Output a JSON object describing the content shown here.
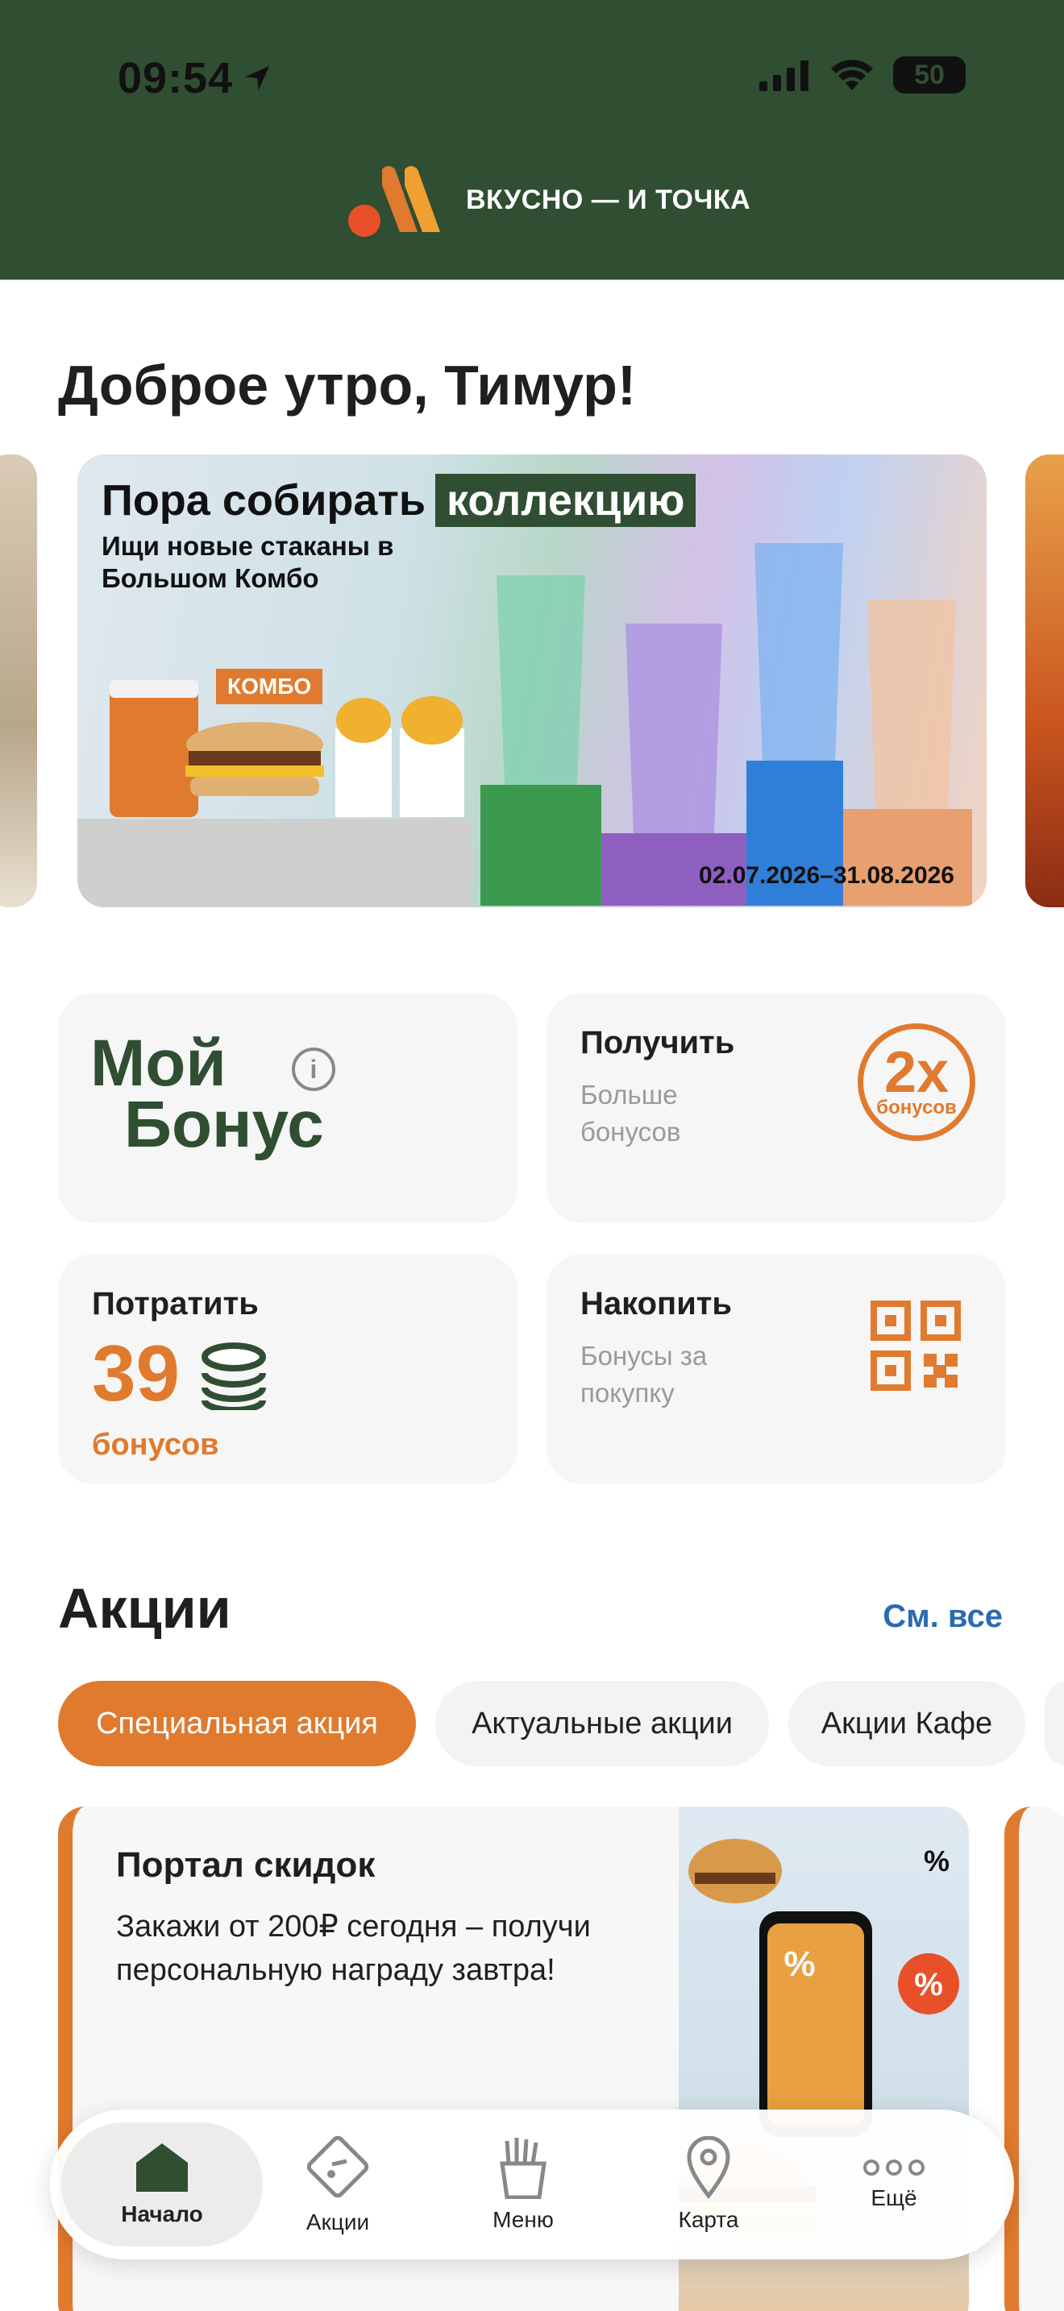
{
  "status": {
    "time": "09:54",
    "battery": "50"
  },
  "brand": {
    "name": "ВКУСНО — И ТОЧКА"
  },
  "greeting": "Доброе утро, Тимур!",
  "banner": {
    "title_plain": "Пора собирать",
    "title_highlight": "коллекцию",
    "subtitle": "Ищи новые стаканы в Большом Комбо",
    "badge": "КОМБО",
    "dates": "02.07.2026–31.08.2026"
  },
  "bonus": {
    "my_bonus_line1": "Мой",
    "my_bonus_line2": "Бонус",
    "info_icon": "i",
    "get": {
      "title": "Получить",
      "subtitle": "Больше бонусов",
      "badge_big": "2x",
      "badge_small": "бонусов"
    },
    "spend": {
      "title": "Потратить",
      "amount": "39",
      "unit": "бонусов"
    },
    "earn": {
      "title": "Накопить",
      "subtitle": "Бонусы за покупку"
    }
  },
  "promotions": {
    "title": "Акции",
    "see_all": "См. все",
    "chips": [
      "Специальная акция",
      "Актуальные акции",
      "Акции Кафе"
    ],
    "card": {
      "title": "Портал скидок",
      "text": "Закажи от 200₽ сегодня – получи персональную награду завтра!"
    }
  },
  "tabbar": {
    "items": [
      "Начало",
      "Акции",
      "Меню",
      "Карта",
      "Ещё"
    ]
  },
  "colors": {
    "brand_green": "#2f4e32",
    "accent_orange": "#e07a2e",
    "link_blue": "#2b6bb0"
  }
}
